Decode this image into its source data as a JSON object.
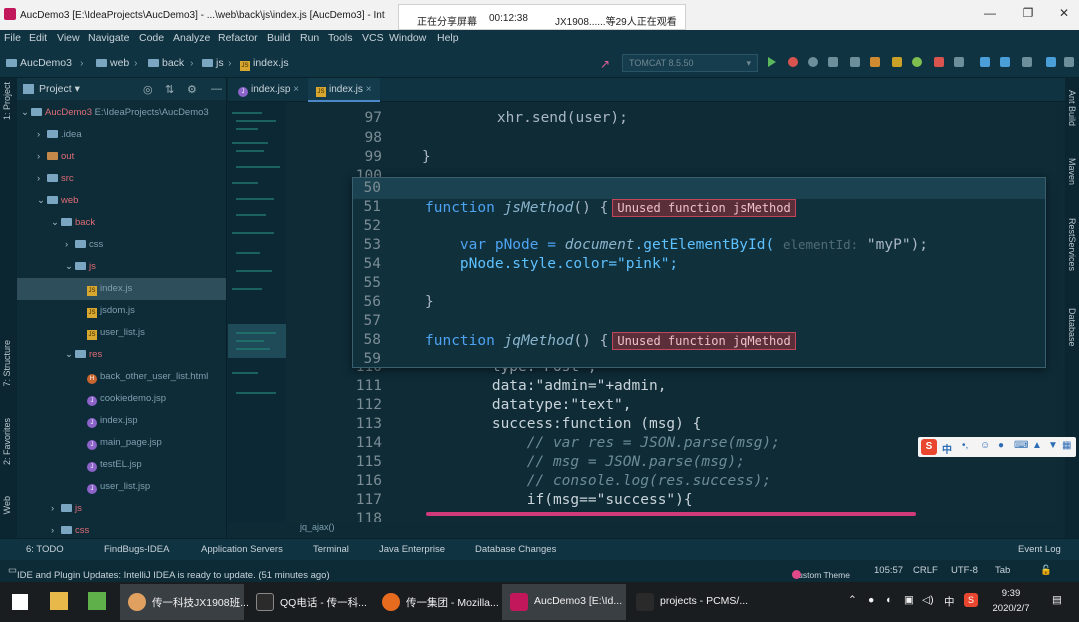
{
  "window": {
    "title": "AucDemo3 [E:\\IdeaProjects\\AucDemo3] - ...\\web\\back\\js\\index.js [AucDemo3] - Int",
    "share_banner": {
      "status": "正在分享屏幕",
      "time": "00:12:38",
      "viewers": "JX1908......等29人正在观看"
    }
  },
  "menu": [
    "File",
    "Edit",
    "View",
    "Navigate",
    "Code",
    "Analyze",
    "Refactor",
    "Build",
    "Run",
    "Tools",
    "VCS",
    "Window",
    "Help"
  ],
  "nav": {
    "crumbs": [
      "AucDemo3",
      "web",
      "back",
      "js",
      "index.js"
    ],
    "run_config": "TOMCAT 8.5.50"
  },
  "project_panel": {
    "label": "Project",
    "tree": [
      {
        "label": "AucDemo3",
        "extra": "E:\\IdeaProjects\\AucDemo3"
      },
      {
        "label": ".idea"
      },
      {
        "label": "out"
      },
      {
        "label": "src"
      },
      {
        "label": "web"
      },
      {
        "label": "back"
      },
      {
        "label": "css"
      },
      {
        "label": "js"
      },
      {
        "label": "index.js"
      },
      {
        "label": "jsdom.js"
      },
      {
        "label": "user_list.js"
      },
      {
        "label": "res"
      },
      {
        "label": "back_other_user_list.html"
      },
      {
        "label": "cookiedemo.jsp"
      },
      {
        "label": "index.jsp"
      },
      {
        "label": "main_page.jsp"
      },
      {
        "label": "testEL.jsp"
      },
      {
        "label": "user_list.jsp"
      },
      {
        "label": "js"
      },
      {
        "label": "css"
      }
    ]
  },
  "left_tabs": [
    "1: Project",
    "7: Structure",
    "2: Favorites",
    "Web"
  ],
  "right_tabs": [
    "Ant Build",
    "Maven",
    "RestServices",
    "Database"
  ],
  "editor_tabs": [
    {
      "label": "index.jsp"
    },
    {
      "label": "index.js"
    }
  ],
  "editor": {
    "lines": [
      {
        "n": "97",
        "text": "    xhr.send(user);"
      },
      {
        "n": "98",
        "text": ""
      },
      {
        "n": "99",
        "text": "}"
      },
      {
        "n": "100",
        "text": ""
      },
      {
        "n": "110",
        "text": "        type:\"Post\","
      },
      {
        "n": "111",
        "text": "        data:\"admin=\"+admin,"
      },
      {
        "n": "112",
        "text": "        datatype:\"text\","
      },
      {
        "n": "113",
        "text": "        success:function (msg) {"
      },
      {
        "n": "114",
        "text": "            // var res = JSON.parse(msg);"
      },
      {
        "n": "115",
        "text": "            // msg = JSON.parse(msg);"
      },
      {
        "n": "116",
        "text": "            // console.log(res.success);"
      },
      {
        "n": "117",
        "text": "            if(msg==\"success\"){"
      },
      {
        "n": "118",
        "text": ""
      }
    ],
    "popup": {
      "lines": [
        {
          "n": "50"
        },
        {
          "n": "51"
        },
        {
          "n": "52"
        },
        {
          "n": "53"
        },
        {
          "n": "54"
        },
        {
          "n": "55"
        },
        {
          "n": "56"
        },
        {
          "n": "57"
        },
        {
          "n": "58"
        },
        {
          "n": "59"
        }
      ],
      "l51": {
        "kw": "function",
        "name": "jsMethod",
        "rest": "() {",
        "badge": "Unused function jsMethod"
      },
      "l53": {
        "a": "    var pNode = ",
        "b": "document",
        "c": ".getElementById( ",
        "hint": "elementId:",
        "d": " \"myP\");"
      },
      "l54": "    pNode.style.color=\"pink\";",
      "l56": "}",
      "l58": {
        "kw": "function",
        "name": "jqMethod",
        "rest": "() {",
        "badge": "Unused function jqMethod"
      }
    },
    "bottom_crumb": "jq_ajax()"
  },
  "ime": {
    "label": "中"
  },
  "toolwin": [
    "6: TODO",
    "FindBugs-IDEA",
    "Application Servers",
    "Terminal",
    "Java Enterprise",
    "Database Changes",
    "Event Log"
  ],
  "status": {
    "message": "IDE and Plugin Updates: IntelliJ IDEA is ready to update. (51 minutes ago)",
    "theme": "Custom Theme",
    "position": "105:57",
    "line_sep": "CRLF",
    "encoding": "UTF-8",
    "indent": "Tab"
  },
  "taskbar": {
    "tasks": [
      "传一科技JX1908班...",
      "QQ电话 - 传一科...",
      "传一集团 - Mozilla...",
      "AucDemo3 [E:\\Id...",
      "projects - PCMS/..."
    ],
    "ime": "中",
    "time": "9:39",
    "date": "2020/2/7"
  }
}
